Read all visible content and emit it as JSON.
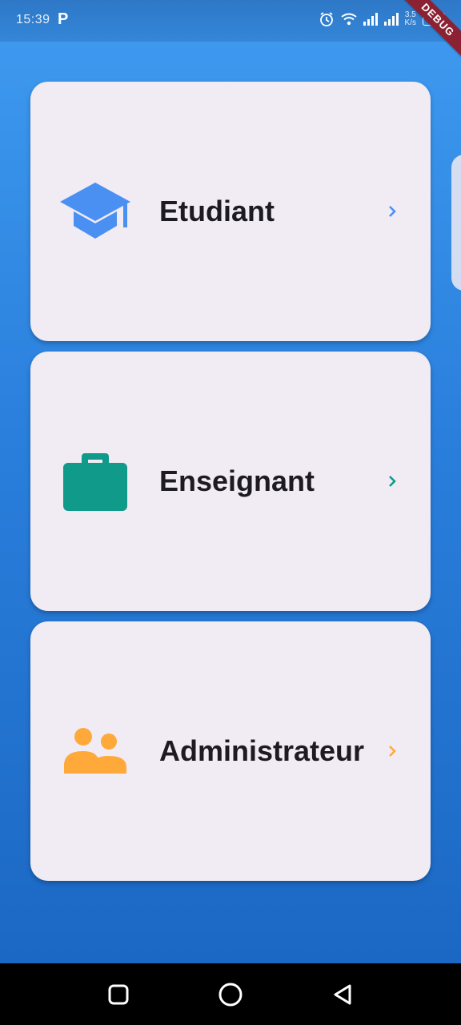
{
  "status_bar": {
    "time": "15:39",
    "app_badge": "P",
    "net_speed_top": "3.5",
    "net_speed_bottom": "K/s",
    "battery": "24"
  },
  "debug_banner": "DEBUG",
  "roles": [
    {
      "label": "Etudiant",
      "icon": "graduation-cap-icon",
      "color": "#4a8ff2"
    },
    {
      "label": "Enseignant",
      "icon": "briefcase-icon",
      "color": "#0f9a8a"
    },
    {
      "label": "Administrateur",
      "icon": "people-icon",
      "color": "#ffa93b"
    }
  ],
  "colors": {
    "background_top": "#3f9bf0",
    "background_bottom": "#1b68c4",
    "card": "#f1ebf4",
    "text": "#1d1b20"
  }
}
